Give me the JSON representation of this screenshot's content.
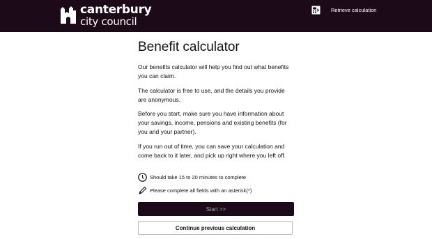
{
  "header": {
    "logo": {
      "icon": "cathedral-icon",
      "line1": "canterbury",
      "line2": "city council"
    },
    "retrieve": {
      "icon": "retrieve-calculation-icon",
      "label": "Retrieve calculation"
    },
    "background_color": "#1c0a18"
  },
  "main": {
    "title": "Benefit calculator",
    "paragraphs": [
      "Our benefits calculator will help you find out what benefits you can claim.",
      "The calculator is free to use, and the details you provide are anonymous.",
      "Before you start, make sure you have information about your savings, income, pensions and existing benefits (for you and your partner).",
      "If you run out of time, you can save your calculation and come back to it later, and pick up right where you left off."
    ],
    "info": [
      {
        "icon": "clock-icon",
        "text": "Should take 15 to 20 minutes to complete"
      },
      {
        "icon": "pencil-icon",
        "text": "Please complete all fields with an asterisk(*)"
      }
    ],
    "start_label": "Start >>",
    "continue_label": "Continue previous calculation"
  }
}
